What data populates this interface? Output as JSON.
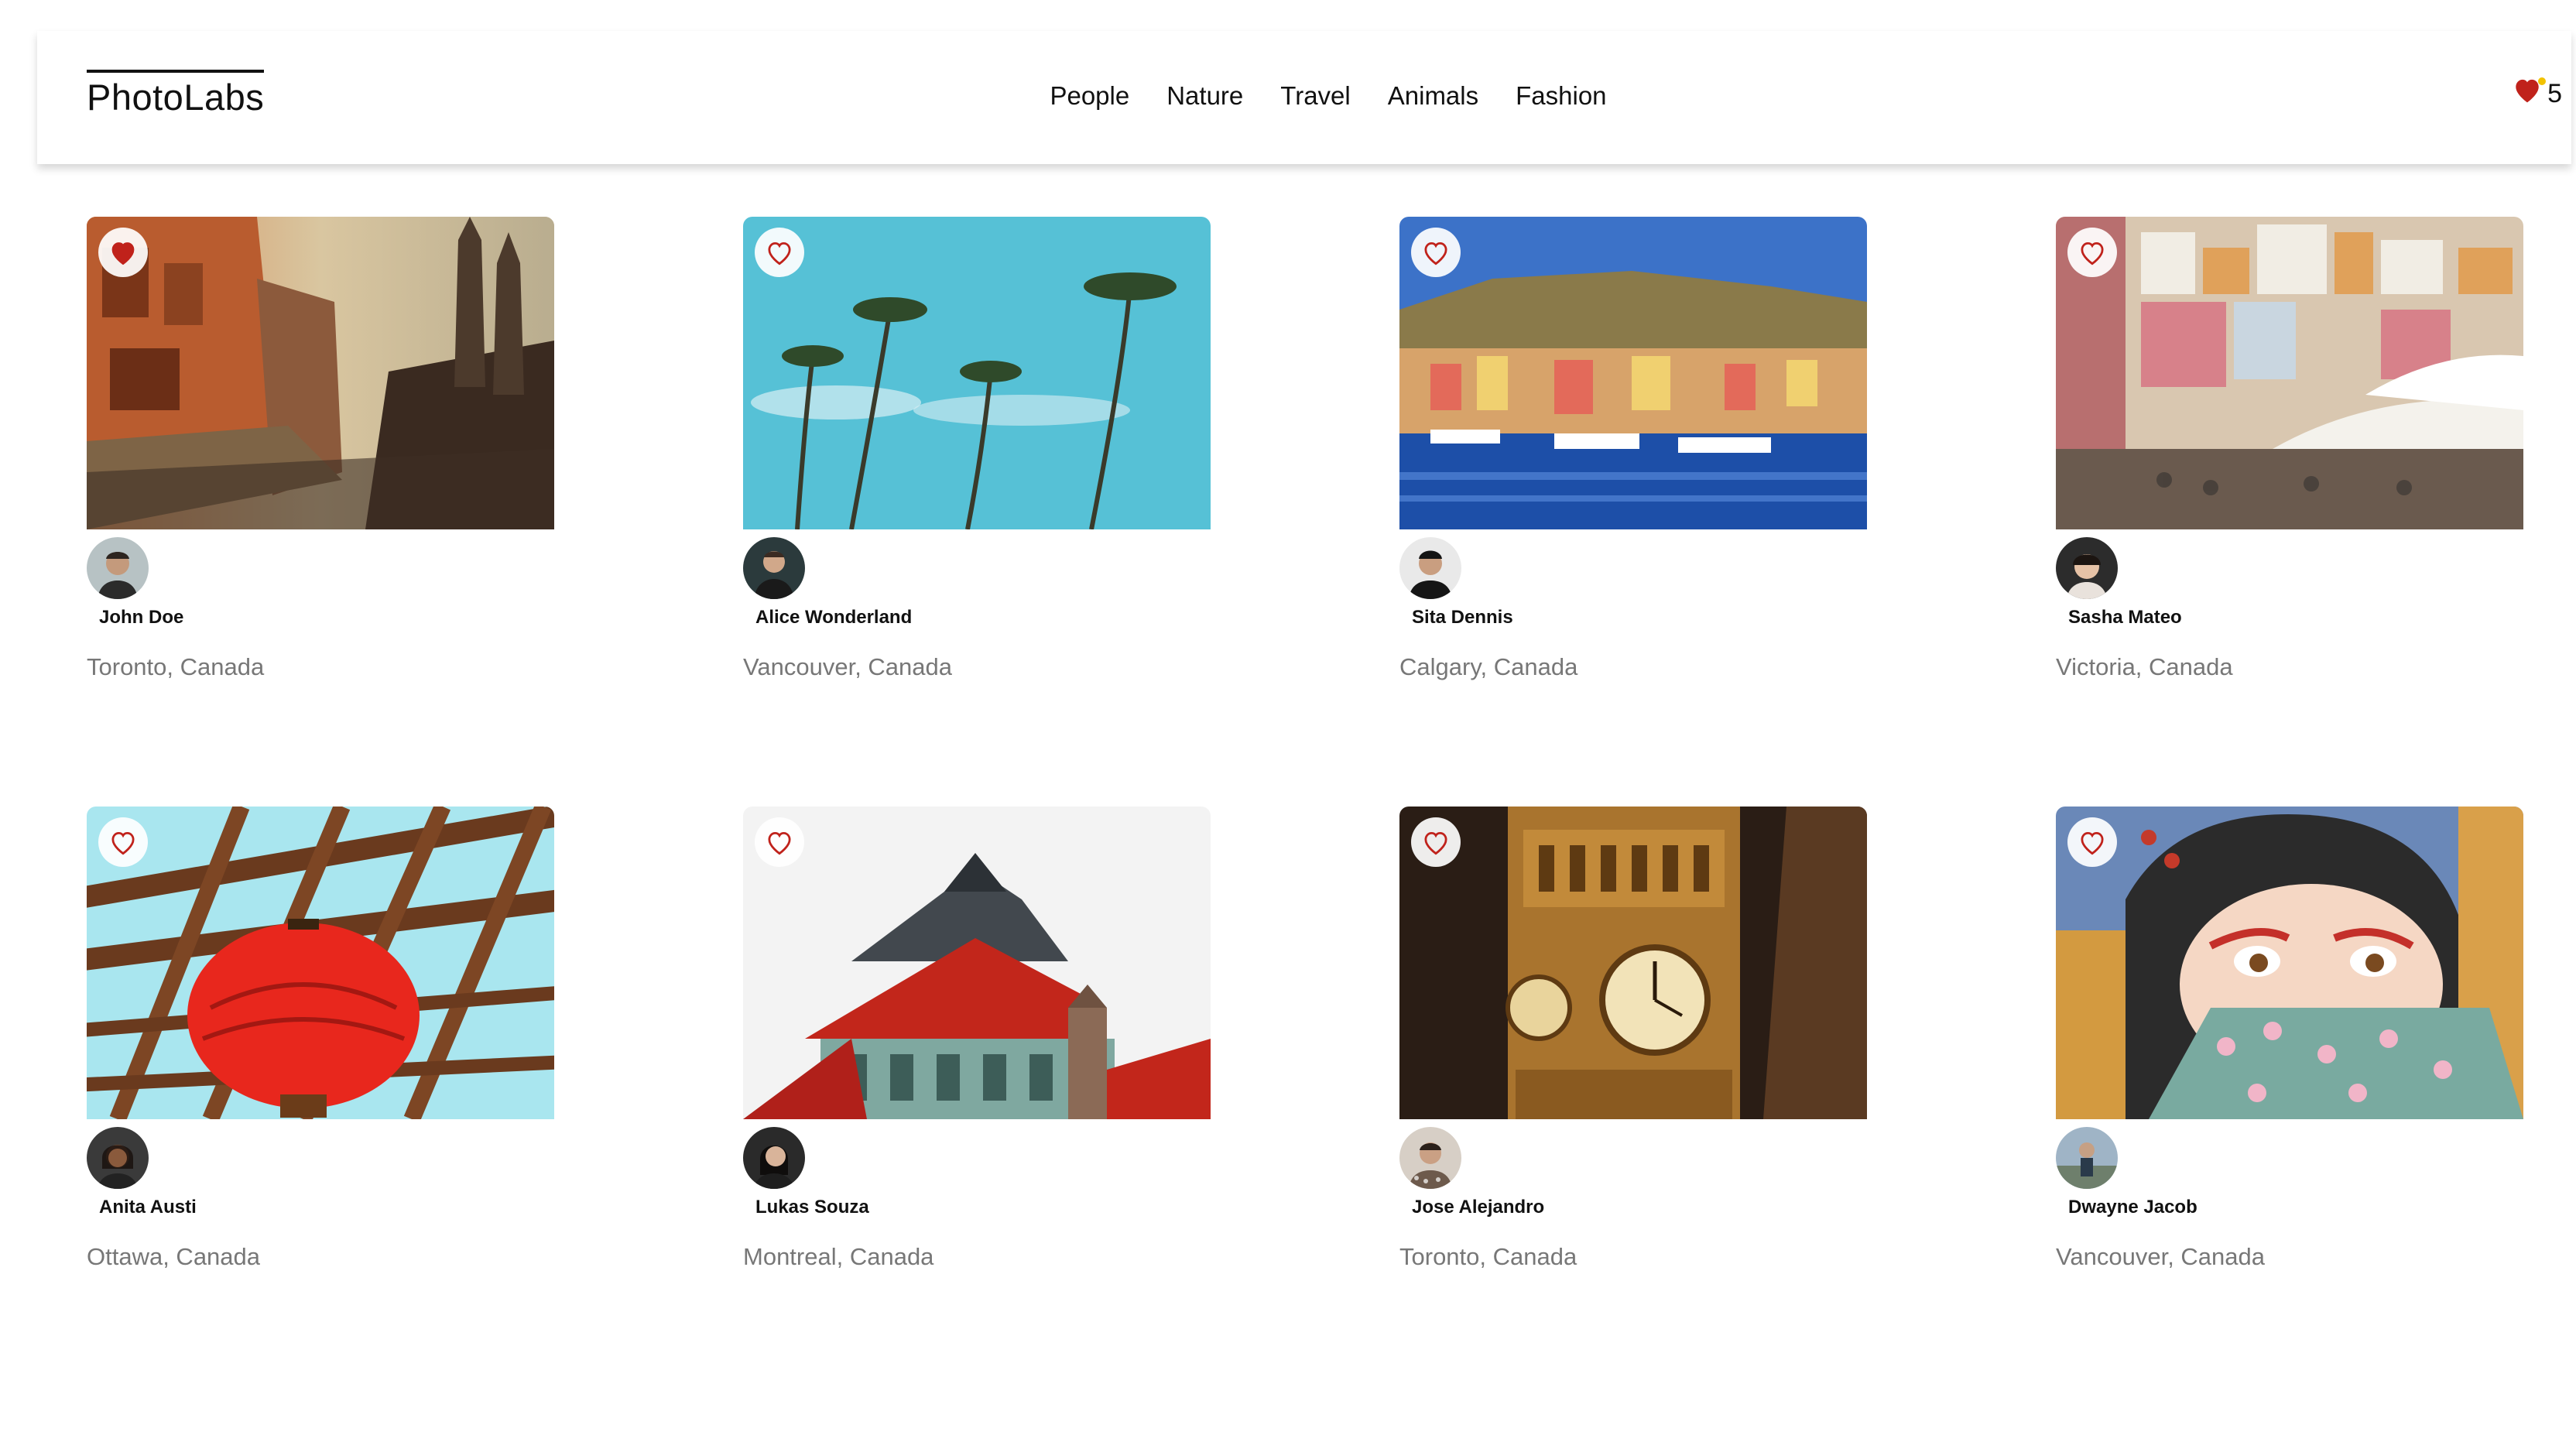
{
  "app": {
    "logo_text": "PhotoLabs",
    "topics": [
      "People",
      "Nature",
      "Travel",
      "Animals",
      "Fashion"
    ],
    "favourites_count": "5",
    "accent_color": "#c0221b"
  },
  "photos": [
    {
      "author": "John Doe",
      "location": "Toronto, Canada",
      "liked": true,
      "scene": "old-street"
    },
    {
      "author": "Alice Wonderland",
      "location": "Vancouver, Canada",
      "liked": false,
      "scene": "palm-trees"
    },
    {
      "author": "Sita Dennis",
      "location": "Calgary, Canada",
      "liked": false,
      "scene": "harbour"
    },
    {
      "author": "Sasha Mateo",
      "location": "Victoria, Canada",
      "liked": false,
      "scene": "hillside-town"
    },
    {
      "author": "Anita Austi",
      "location": "Ottawa, Canada",
      "liked": false,
      "scene": "red-lantern"
    },
    {
      "author": "Lukas Souza",
      "location": "Montreal, Canada",
      "liked": false,
      "scene": "pagoda"
    },
    {
      "author": "Jose Alejandro",
      "location": "Toronto, Canada",
      "liked": false,
      "scene": "clock-tower"
    },
    {
      "author": "Dwayne Jacob",
      "location": "Vancouver, Canada",
      "liked": false,
      "scene": "geisha-mural"
    }
  ]
}
